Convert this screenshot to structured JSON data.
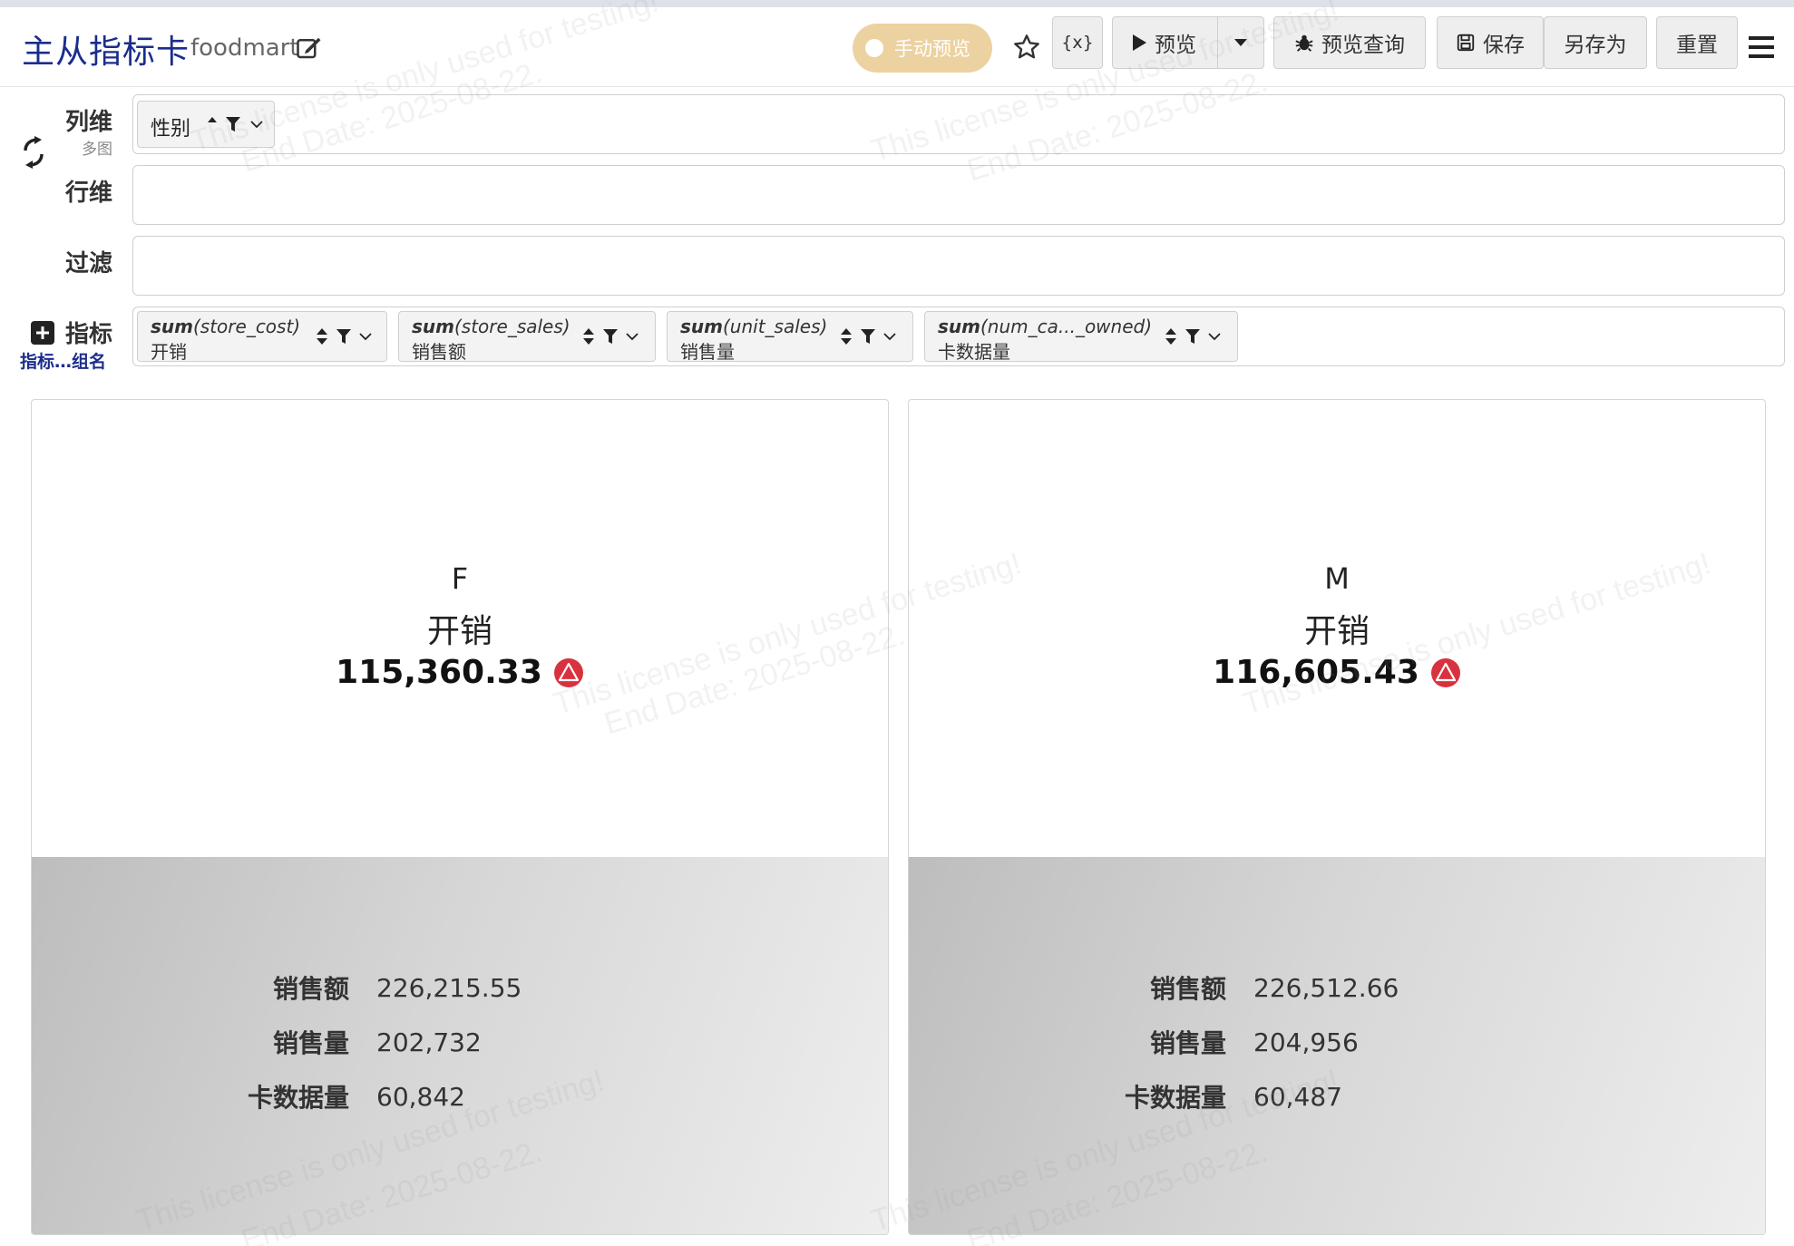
{
  "header": {
    "title": "主从指标卡",
    "subtitle": "foodmart",
    "toggle_label": "手动预览",
    "variable_label": "{x}",
    "preview_label": "预览",
    "preview_query_label": "预览查询",
    "save_label": "保存",
    "save_as_label": "另存为",
    "reset_label": "重置"
  },
  "config": {
    "column_dim_label": "列维",
    "column_dim_sub": "多图",
    "row_dim_label": "行维",
    "filter_label": "过滤",
    "metric_label": "指标",
    "metric_sub": "指标…组名",
    "column_chips": [
      {
        "label": "性别"
      }
    ],
    "metric_chips": [
      {
        "func": "sum",
        "field": "(store_cost)",
        "alias": "开销"
      },
      {
        "func": "sum",
        "field": "(store_sales)",
        "alias": "销售额"
      },
      {
        "func": "sum",
        "field": "(unit_sales)",
        "alias": "销售量"
      },
      {
        "func": "sum",
        "field": "(num_ca..._owned)",
        "alias": "卡数据量"
      }
    ]
  },
  "cards": [
    {
      "dimension": "F",
      "main_metric": "开销",
      "main_value": "115,360.33",
      "sub_metrics": [
        {
          "name": "销售额",
          "value": "226,215.55"
        },
        {
          "name": "销售量",
          "value": "202,732"
        },
        {
          "name": "卡数据量",
          "value": "60,842"
        }
      ]
    },
    {
      "dimension": "M",
      "main_metric": "开销",
      "main_value": "116,605.43",
      "sub_metrics": [
        {
          "name": "销售额",
          "value": "226,512.66"
        },
        {
          "name": "销售量",
          "value": "204,956"
        },
        {
          "name": "卡数据量",
          "value": "60,487"
        }
      ]
    }
  ],
  "watermark": {
    "line1": "This license is only used for testing!",
    "line2": "End Date: 2025-08-22."
  },
  "colors": {
    "title": "#1b2d8c",
    "toggle": "#ecd2a0",
    "warning": "#d9323f"
  }
}
